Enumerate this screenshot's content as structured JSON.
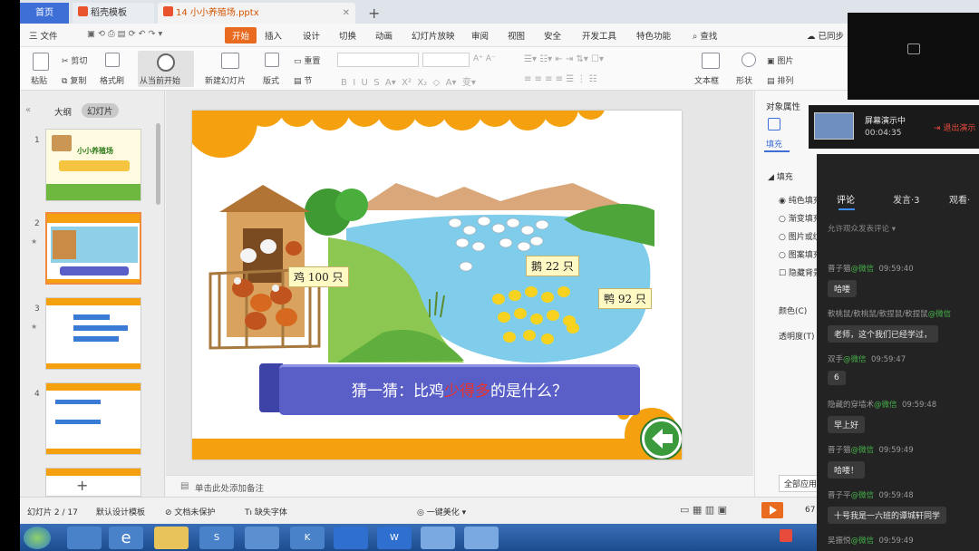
{
  "tabs": {
    "home": "首页",
    "templates": "稻壳模板",
    "file": "14 小小养殖场.pptx"
  },
  "menubar": {
    "file": "三 文件",
    "items": [
      "开始",
      "插入",
      "设计",
      "切换",
      "动画",
      "幻灯片放映",
      "审阅",
      "视图",
      "安全",
      "开发工具",
      "特色功能"
    ],
    "search": "查找",
    "sync": "已同步"
  },
  "ribbon": {
    "paste": "粘贴",
    "cut": "剪切",
    "copy": "复制",
    "format_painter": "格式刷",
    "from_current": "从当前开始",
    "new_slide": "新建幻灯片",
    "layout": "版式",
    "section": "节",
    "reset": "重置",
    "textbox": "文本框",
    "shape": "形状",
    "arrange": "排列",
    "picture": "图片"
  },
  "left_panel": {
    "outline_tab": "大纲",
    "slides_tab": "幻灯片",
    "slide_numbers": [
      "1",
      "2",
      "3",
      "4"
    ],
    "thumb1_title": "小小养殖场"
  },
  "slide": {
    "chicken_label": "鸡 100 只",
    "goose_label": "鹅 22 只",
    "duck_label": "鸭 92 只",
    "question_pre": "猜一猜：比鸡",
    "question_highlight": "少得多",
    "question_post": "的是什么？"
  },
  "notes_placeholder": "单击此处添加备注",
  "right_pane": {
    "title": "对象属性",
    "tab_fill": "填充",
    "section_fill": "填充",
    "options": [
      "纯色填充",
      "渐变填充",
      "图片或纹",
      "图案填充"
    ],
    "hide_bg": "隐藏背景",
    "color": "颜色(C)",
    "transparency": "透明度(T)",
    "apply_all": "全部应用"
  },
  "status_bar": {
    "slide_count": "幻灯片 2 / 17",
    "template": "默认设计模板",
    "protect": "文档未保护",
    "font_missing": "缺失字体",
    "beautify": "一键美化",
    "zoom": "67"
  },
  "share": {
    "status": "屏幕演示中",
    "time": "00:04:35",
    "exit": "退出演示"
  },
  "chat": {
    "tabs": [
      "评论",
      "发言·3",
      "观看·"
    ],
    "allow_comments": "允许观众发表评论",
    "messages": [
      {
        "user": "晋子猫",
        "source": "@微信",
        "time": "09:59:40",
        "text": "哈喽"
      },
      {
        "user": "軟桃鼠/軟桃鼠/軟捏鼠/軟捏鼠",
        "source": "@微信",
        "time": "",
        "text": "老师，这个我们已经学过，"
      },
      {
        "user": "双手",
        "source": "@微信",
        "time": "09:59:47",
        "text": "6"
      },
      {
        "user": "隐藏的穿墙术",
        "source": "@微信",
        "time": "09:59:48",
        "text": "早上好"
      },
      {
        "user": "晋子猫",
        "source": "@微信",
        "time": "09:59:49",
        "text": "哈喽！"
      },
      {
        "user": "晋子平",
        "source": "@微信",
        "time": "09:59:48",
        "text": "十号我是一六班的谭城轩同学"
      },
      {
        "user": "吴振悦",
        "source": "@微信",
        "time": "09:59:49",
        "text": ""
      }
    ]
  },
  "colors": {
    "accent_orange": "#f5a00f",
    "wps_tab_blue": "#3d6fd6",
    "question_box": "#5a5fc8",
    "highlight_red": "#e8312a"
  }
}
